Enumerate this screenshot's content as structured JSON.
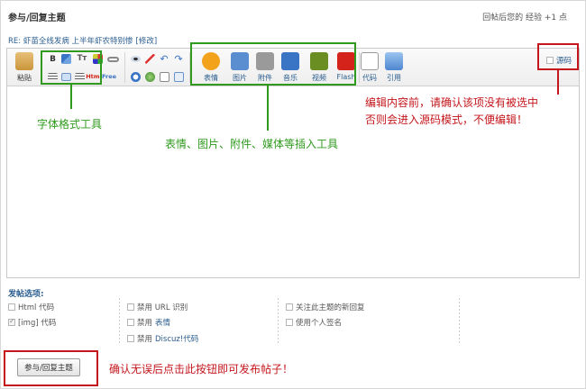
{
  "header": {
    "title": "参与/回复主题",
    "exp_note": "回帖后您的 经验 +1 点"
  },
  "subject": {
    "text": "RE: 虾苗全线发病 上半年虾农特别惨",
    "edit_link": "[修改]"
  },
  "toolbar": {
    "paste_label": "粘贴",
    "source_label": "源码",
    "insert_buttons": [
      {
        "icon": "smiley-icon",
        "label": "表情",
        "color": "#f3a21b"
      },
      {
        "icon": "image-icon",
        "label": "图片",
        "color": "#5a8ed0"
      },
      {
        "icon": "paperclip-icon",
        "label": "附件",
        "color": "#9a9a9a"
      },
      {
        "icon": "music-icon",
        "label": "音乐",
        "color": "#3a74c4"
      },
      {
        "icon": "video-icon",
        "label": "视频",
        "color": "#6b8e23"
      },
      {
        "icon": "flash-icon",
        "label": "Flash",
        "color": "#d3231a"
      }
    ],
    "code_label": "代码",
    "quote_label": "引用",
    "format_glyphs": {
      "bold": "B",
      "font_size": "Tт",
      "html": "Html",
      "free": "Free"
    }
  },
  "annotations": {
    "format_tools": "字体格式工具",
    "insert_tools": "表情、图片、附件、媒体等插入工具",
    "source_warning_line1": "编辑内容前，请确认该项没有被选中",
    "source_warning_line2": "否则会进入源码模式，不便编辑！",
    "submit_hint": "确认无误后点击此按钮即可发布帖子！"
  },
  "options": {
    "title": "发帖选项:",
    "col1": [
      {
        "label": "Html 代码",
        "checked": false
      },
      {
        "label": "[img] 代码",
        "checked": true
      }
    ],
    "col2": [
      {
        "label": "禁用 URL 识别",
        "link": "",
        "checked": false
      },
      {
        "label": "禁用",
        "link": "表情",
        "checked": false
      },
      {
        "label": "禁用",
        "link": "Discuz!代码",
        "checked": false
      }
    ],
    "col3": [
      {
        "label": "关注此主题的新回复",
        "checked": false
      },
      {
        "label": "使用个人签名",
        "checked": false
      }
    ]
  },
  "submit": {
    "label": "参与/回复主题"
  },
  "colors": {
    "annotation_red": "#c4161c",
    "annotation_green": "#2f9a1e",
    "link_blue": "#2a5d8f"
  }
}
